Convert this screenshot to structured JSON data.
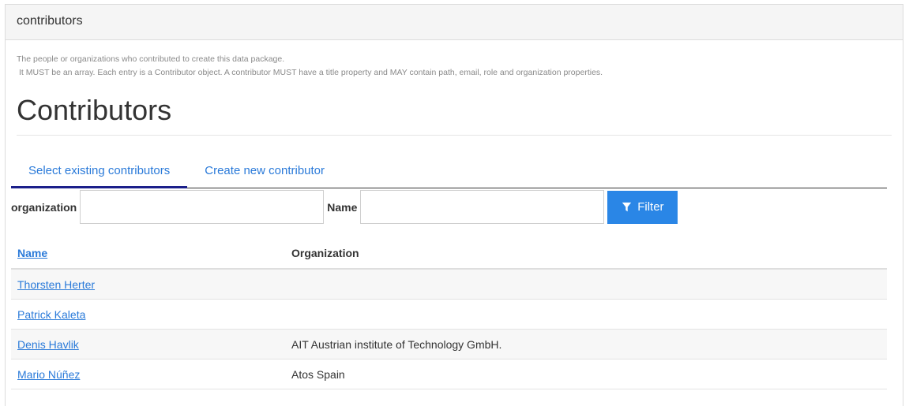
{
  "panel": {
    "heading": "contributors"
  },
  "help": {
    "line1": "The people or organizations who contributed to create this data package.",
    "line2": "It MUST be an array. Each entry is a Contributor object. A contributor MUST have a title property and MAY contain path, email, role and organization properties."
  },
  "page_title": "Contributors",
  "tabs": [
    {
      "label": "Select existing contributors",
      "active": true
    },
    {
      "label": "Create new contributor",
      "active": false
    }
  ],
  "filter": {
    "organization_label": "organization",
    "organization_value": "",
    "name_label": "Name",
    "name_value": "",
    "button_label": "Filter",
    "button_icon": "filter-icon"
  },
  "table": {
    "columns": [
      "Name",
      "Organization"
    ],
    "rows": [
      {
        "name": "Thorsten Herter",
        "organization": ""
      },
      {
        "name": "Patrick Kaleta",
        "organization": ""
      },
      {
        "name": "Denis Havlik",
        "organization": "AIT Austrian institute of Technology GmbH."
      },
      {
        "name": "Mario Núñez",
        "organization": "Atos Spain"
      }
    ]
  },
  "colors": {
    "accent": "#2a86e6",
    "link": "#2a7ad9",
    "tab_active_border": "#1b1f8a"
  }
}
